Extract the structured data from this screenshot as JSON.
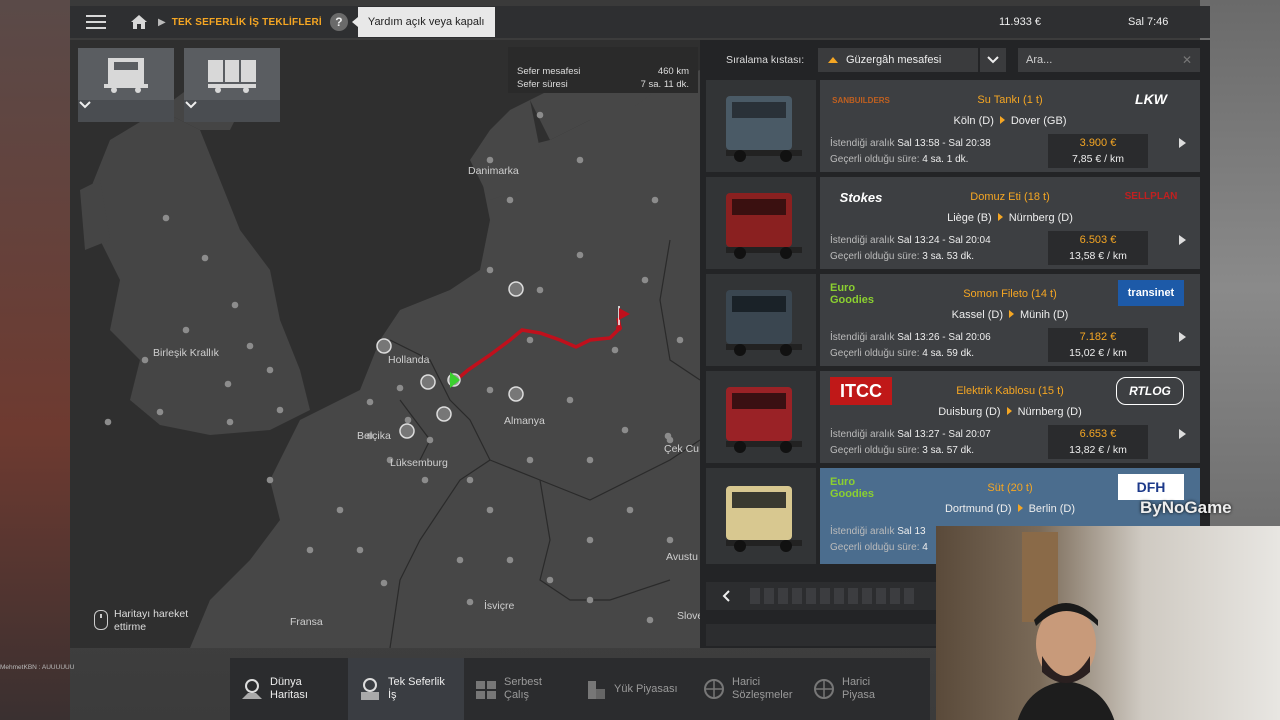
{
  "topbar": {
    "breadcrumb": "TEK SEFERLİK İŞ TEKLİFLERİ",
    "help": "?",
    "tooltip": "Yardım açık veya kapalı",
    "money": "11.933 €",
    "time": "Sal 7:46"
  },
  "map": {
    "info": {
      "distance_label": "Sefer mesafesi",
      "distance_value": "460 km",
      "duration_label": "Sefer süresi",
      "duration_value": "7 sa. 11 dk."
    },
    "labels": [
      "Danimarka",
      "Birleşik Krallık",
      "Hollanda",
      "Belçika",
      "Lüksemburg",
      "Almanya",
      "Çek Cu",
      "Fransa",
      "İsviçre",
      "Avustu",
      "Slove"
    ],
    "hint": "Haritayı hareket ettirme"
  },
  "panel": {
    "sort_label": "Sıralama kıstası:",
    "sort_value": "Güzergâh mesafesi",
    "search_placeholder": "Ara..."
  },
  "jobs": [
    {
      "logo_left": "SANBUILDERS",
      "logo_right": "LKW",
      "cargo": "Su Tankı (1 t)",
      "from": "Köln (D)",
      "to": "Dover (GB)",
      "window_label": "İstendiği aralık",
      "window": "Sal 13:58 - Sal 20:38",
      "valid_label": "Geçerli olduğu süre:",
      "valid": "4 sa. 1 dk.",
      "price": "3.900 €",
      "rate": "7,85 € / km",
      "cab": "#4a5a66",
      "selected": false
    },
    {
      "logo_left": "Stokes",
      "logo_right": "SELLPLAN",
      "cargo": "Domuz Eti (18 t)",
      "from": "Liège (B)",
      "to": "Nürnberg (D)",
      "window_label": "İstendiği aralık",
      "window": "Sal 13:24 - Sal 20:04",
      "valid_label": "Geçerli olduğu süre:",
      "valid": "3 sa. 53 dk.",
      "price": "6.503 €",
      "rate": "13,58 € / km",
      "cab": "#8a2020",
      "selected": false
    },
    {
      "logo_left": "Euro Goodies",
      "logo_right": "transinet",
      "cargo": "Somon Fileto (14 t)",
      "from": "Kassel (D)",
      "to": "Münih (D)",
      "window_label": "İstendiği aralık",
      "window": "Sal 13:26 - Sal 20:06",
      "valid_label": "Geçerli olduğu süre:",
      "valid": "4 sa. 59 dk.",
      "price": "7.182 €",
      "rate": "15,02 € / km",
      "cab": "#3a4650",
      "selected": false
    },
    {
      "logo_left": "ITCC",
      "logo_right": "RTLOG",
      "cargo": "Elektrik Kablosu (15 t)",
      "from": "Duisburg (D)",
      "to": "Nürnberg (D)",
      "window_label": "İstendiği aralık",
      "window": "Sal 13:27 - Sal 20:07",
      "valid_label": "Geçerli olduğu süre:",
      "valid": "3 sa. 57 dk.",
      "price": "6.653 €",
      "rate": "13,82 € / km",
      "cab": "#9a2226",
      "selected": false
    },
    {
      "logo_left": "Euro Goodies",
      "logo_right": "DFH",
      "cargo": "Süt (20 t)",
      "from": "Dortmund (D)",
      "to": "Berlin (D)",
      "window_label": "İstendiği aralık",
      "window": "Sal 13",
      "valid_label": "Geçerli olduğu süre:",
      "valid": "4",
      "price": "",
      "rate": "",
      "cab": "#d8c890",
      "selected": true
    }
  ],
  "tabs": [
    {
      "label": "Dünya\nHaritası",
      "icon": "world-map-icon",
      "active": false
    },
    {
      "label": "Tek Seferlik\nİş",
      "icon": "quick-job-icon",
      "active": true
    },
    {
      "label": "Serbest\nÇalış",
      "icon": "freight-market-icon",
      "active": false
    },
    {
      "label": "Yük Piyasası",
      "icon": "cargo-market-icon",
      "active": false
    },
    {
      "label": "Harici\nSözleşmeler",
      "icon": "external-contracts-icon",
      "active": false
    },
    {
      "label": "Harici\nPiyasa",
      "icon": "external-market-icon",
      "active": false
    }
  ],
  "overlay": {
    "watermark": "ByNoGame",
    "chat": "MehmetKBN : AUUUUUU"
  },
  "colors": {
    "accent": "#f5a623",
    "selected": "#4b6d8e",
    "route": "#c0101c"
  }
}
